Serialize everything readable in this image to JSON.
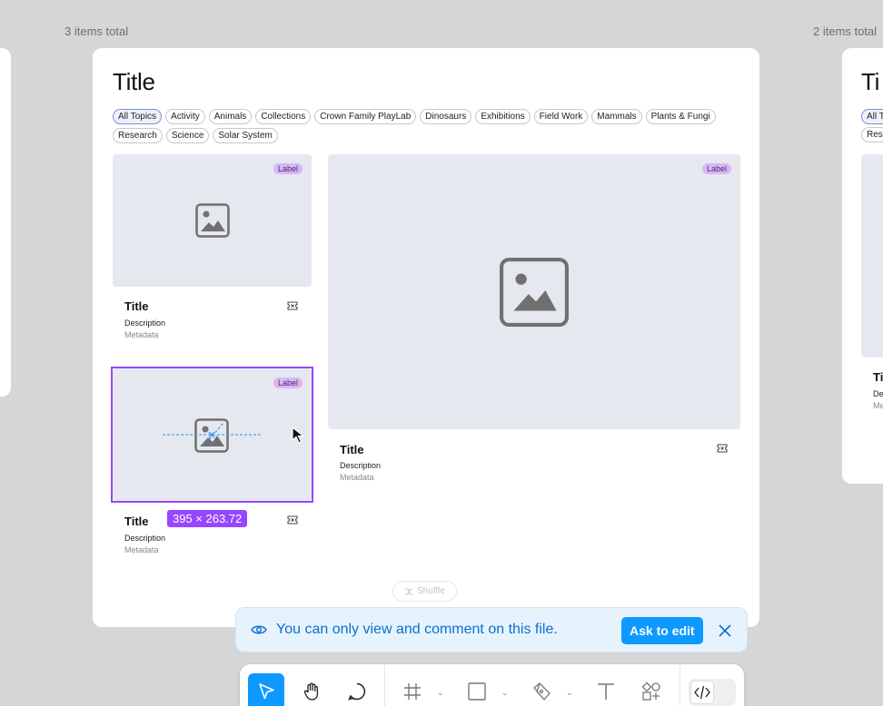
{
  "canvas": {
    "left_count": "3 items total",
    "right_count": "2 items total"
  },
  "main_frame": {
    "title": "Title",
    "chips": [
      "All Topics",
      "Activity",
      "Animals",
      "Collections",
      "Crown Family PlayLab",
      "Dinosaurs",
      "Exhibitions",
      "Field Work",
      "Mammals",
      "Plants & Fungi",
      "Research",
      "Science",
      "Solar System"
    ],
    "cards": [
      {
        "label": "Label",
        "title": "Title",
        "description": "Description",
        "metadata": "Metadata"
      },
      {
        "label": "Label",
        "title": "Title",
        "description": "Description",
        "metadata": "Metadata"
      },
      {
        "label": "Label",
        "title": "Title",
        "description": "Description",
        "metadata": "Metadata"
      }
    ],
    "selection_size": "395 × 263.72",
    "shuffle_label": "Shuffle"
  },
  "right_frame": {
    "title_partial": "Ti",
    "chip1": "All T",
    "chip2": "Res",
    "card_title": "Ti",
    "card_desc": "De",
    "card_meta": "Me"
  },
  "notice": {
    "text": "You can only view and comment on this file.",
    "button": "Ask to edit"
  },
  "toolbar": {
    "tools": [
      "move-tool",
      "hand-tool",
      "comment-tool",
      "frame-tool",
      "shape-tool",
      "pen-tool",
      "text-tool",
      "components-tool",
      "dev-mode-toggle"
    ]
  },
  "colors": {
    "accent": "#0d99ff",
    "selection": "#9747ff",
    "label_bg": "#d9b6f5",
    "notice_bg": "#e6f3fd"
  }
}
